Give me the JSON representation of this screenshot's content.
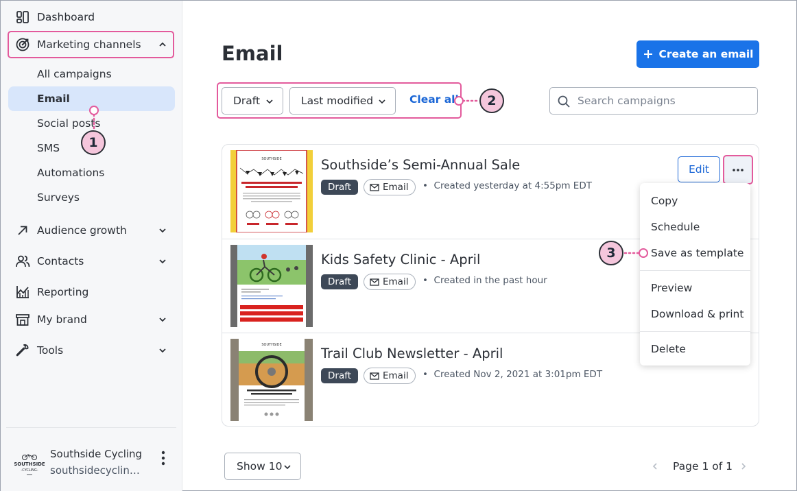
{
  "sidebar": {
    "items": [
      {
        "label": "Dashboard",
        "icon": "dashboard-icon"
      },
      {
        "label": "Marketing channels",
        "icon": "target-icon"
      },
      {
        "label": "Audience growth",
        "icon": "arrow-up-right-icon"
      },
      {
        "label": "Contacts",
        "icon": "contacts-icon"
      },
      {
        "label": "Reporting",
        "icon": "chart-icon"
      },
      {
        "label": "My brand",
        "icon": "store-icon"
      },
      {
        "label": "Tools",
        "icon": "wrench-icon"
      }
    ],
    "sub_items": [
      {
        "label": "All campaigns"
      },
      {
        "label": "Email"
      },
      {
        "label": "Social posts"
      },
      {
        "label": "SMS"
      },
      {
        "label": "Automations"
      },
      {
        "label": "Surveys"
      }
    ],
    "account": {
      "name": "Southside Cycling",
      "url": "southsidecyclin…",
      "logo_text": "SOUTHSIDE"
    }
  },
  "main": {
    "title": "Email",
    "create_button": "Create an email",
    "filters": {
      "status": "Draft",
      "sort": "Last modified",
      "clear_all": "Clear all"
    },
    "search_placeholder": "Search campaigns",
    "campaigns": [
      {
        "title": "Southside’s Semi-Annual Sale",
        "status": "Draft",
        "type": "Email",
        "meta": "Created yesterday at 4:55pm EDT"
      },
      {
        "title": "Kids Safety Clinic - April",
        "status": "Draft",
        "type": "Email",
        "meta": "Created in the past hour"
      },
      {
        "title": "Trail Club Newsletter - April",
        "status": "Draft",
        "type": "Email",
        "meta": "Created Nov 2, 2021 at 3:01pm EDT"
      }
    ],
    "edit_label": "Edit",
    "menu": {
      "items": [
        "Copy",
        "Schedule",
        "Save as template",
        "Preview",
        "Download & print",
        "Delete"
      ]
    },
    "show_label": "Show 10",
    "pager": "Page 1 of 1"
  },
  "callouts": [
    "1",
    "2",
    "3"
  ],
  "colors": {
    "accent": "#1a73e8",
    "highlight": "#e35a9c",
    "callout_fill": "#f5c6dc",
    "active_nav": "#d8e6fb",
    "draft_badge": "#3d4857"
  }
}
